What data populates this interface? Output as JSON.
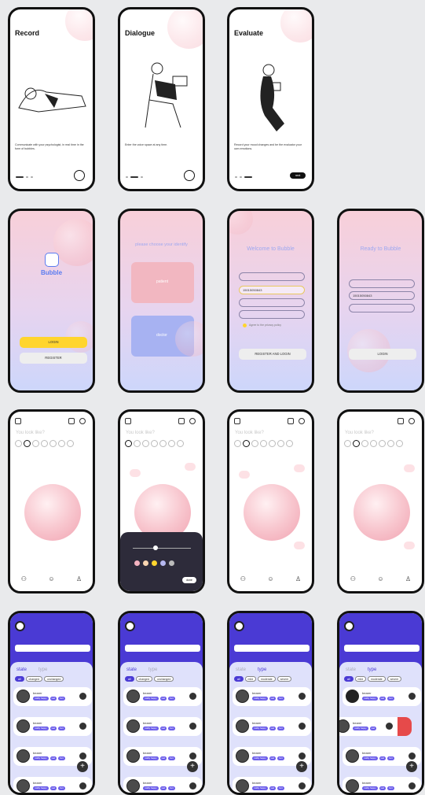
{
  "onboarding": [
    {
      "title": "Record",
      "desc": "Communicate with your psychologist, in real time in the form of bubbles."
    },
    {
      "title": "Dialogue",
      "desc": "Enter the voice space at any time."
    },
    {
      "title": "Evaluate",
      "desc": "Record your mood changes and be the evaluator your own emotions.",
      "next": "next"
    }
  ],
  "splash": {
    "app_name": "Bubble",
    "login": "LOGIN",
    "register": "REGISTER"
  },
  "identify": {
    "title": "please choose your identify",
    "option1": "patient",
    "option2": "doctor"
  },
  "welcome": {
    "title": "Welcome to Bubble",
    "phone": "15015050843",
    "agree": "Agree to the privacy policy",
    "button": "REGISTER AND LOGIN"
  },
  "ready": {
    "title": "Ready to Bubble",
    "phone": "15015050843",
    "button": "LOGIN"
  },
  "mood": {
    "prompt": "You look like?",
    "done": "done"
  },
  "list": {
    "tab_state": "state",
    "tab_type": "type",
    "chips_state": [
      "all",
      "changed",
      "unchanged"
    ],
    "chips_type": [
      "all",
      "mild",
      "moderate",
      "severe"
    ],
    "row_name": "bearer",
    "row_pills": [
      "mildly happy",
      "sad",
      "hurt"
    ]
  },
  "colors": {
    "accent": "#4a3ad4",
    "pink": "#f4b3c0",
    "yellow": "#ffd52e"
  }
}
